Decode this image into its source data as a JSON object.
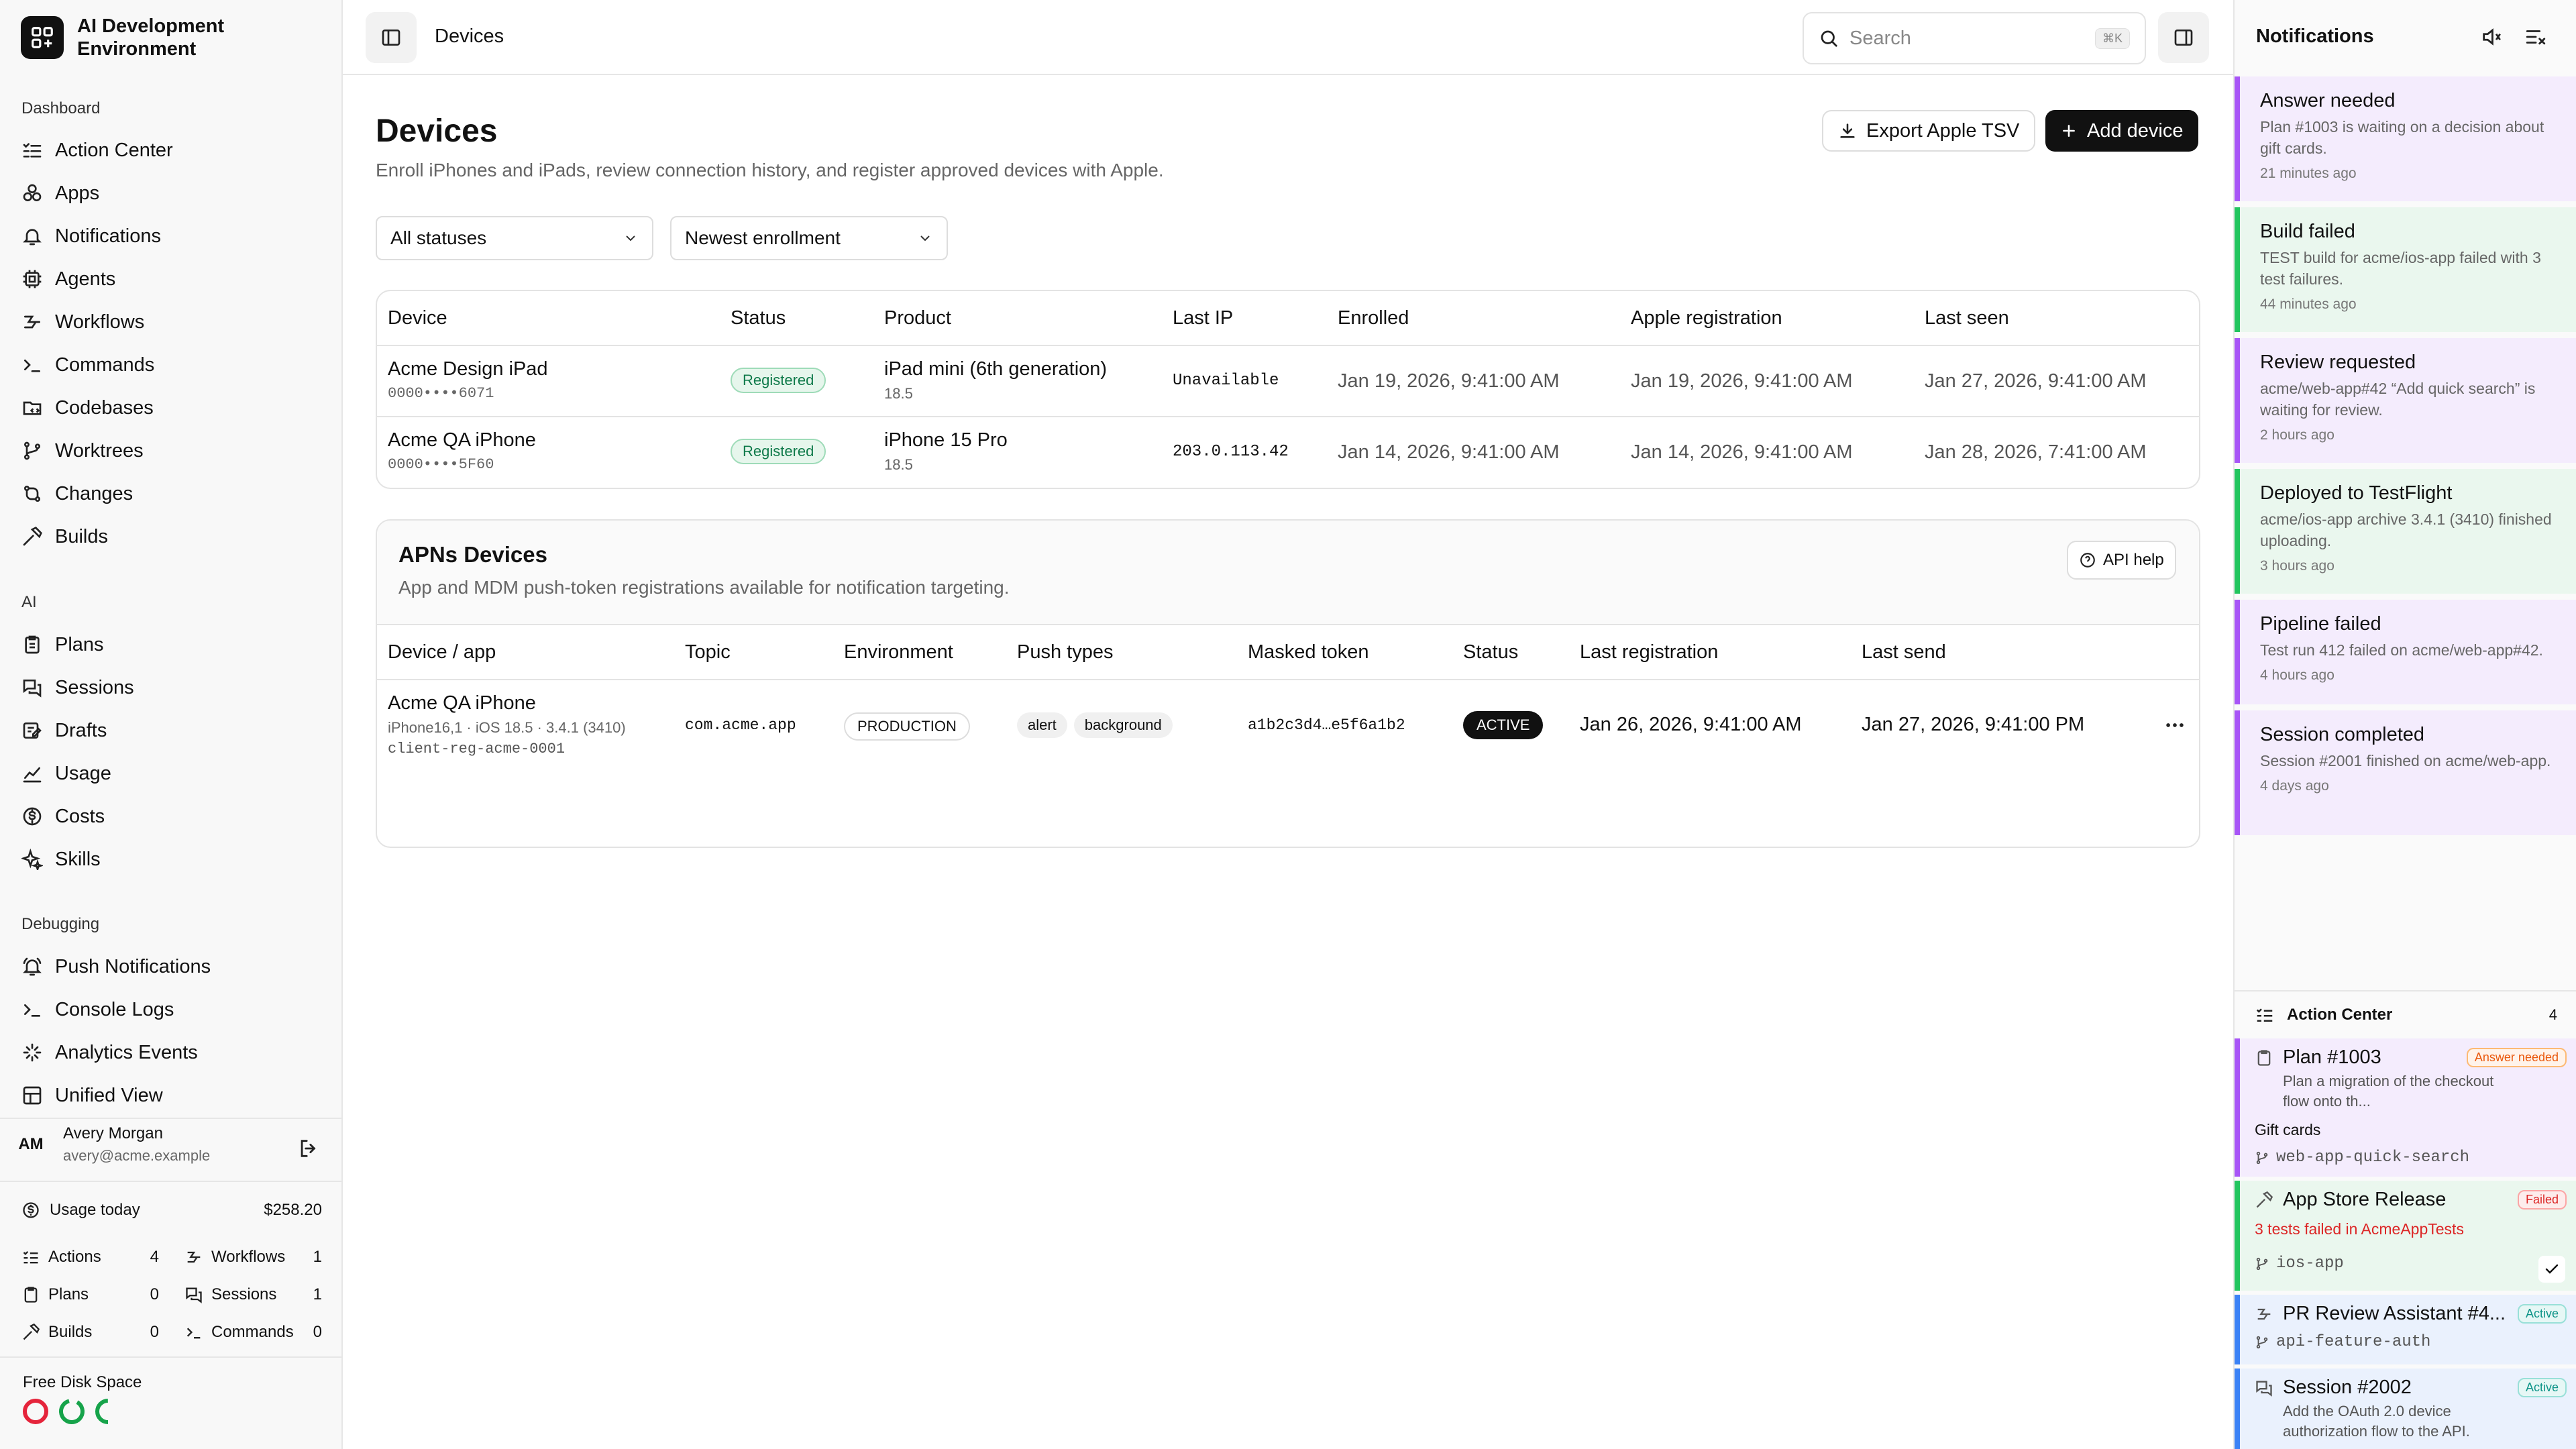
{
  "app": {
    "title": "AI Development Environment"
  },
  "sidebar": {
    "groups": [
      "Dashboard",
      "AI",
      "Debugging"
    ],
    "items": [
      {
        "label": "Action Center",
        "icon": "list-check-icon"
      },
      {
        "label": "Apps",
        "icon": "apps-icon"
      },
      {
        "label": "Notifications",
        "icon": "bell-icon"
      },
      {
        "label": "Agents",
        "icon": "agent-icon"
      },
      {
        "label": "Workflows",
        "icon": "workflow-icon"
      },
      {
        "label": "Commands",
        "icon": "terminal-icon"
      },
      {
        "label": "Codebases",
        "icon": "folder-icon"
      },
      {
        "label": "Worktrees",
        "icon": "branch-icon"
      },
      {
        "label": "Changes",
        "icon": "diff-icon"
      },
      {
        "label": "Builds",
        "icon": "hammer-icon"
      },
      {
        "label": "Plans",
        "icon": "clipboard-icon"
      },
      {
        "label": "Sessions",
        "icon": "chat-icon"
      },
      {
        "label": "Drafts",
        "icon": "draft-icon"
      },
      {
        "label": "Usage",
        "icon": "chart-icon"
      },
      {
        "label": "Costs",
        "icon": "dollar-icon"
      },
      {
        "label": "Skills",
        "icon": "sparkle-icon"
      },
      {
        "label": "Push Notifications",
        "icon": "bell-ring-icon"
      },
      {
        "label": "Console Logs",
        "icon": "terminal-icon"
      },
      {
        "label": "Analytics Events",
        "icon": "activity-icon"
      },
      {
        "label": "Unified View",
        "icon": "layout-icon"
      }
    ],
    "user": {
      "initials": "AM",
      "name": "Avery Morgan",
      "email": "avery@acme.example"
    },
    "usage": {
      "label": "Usage today",
      "value": "$258.20"
    },
    "stats": [
      {
        "label": "Actions",
        "value": "4"
      },
      {
        "label": "Workflows",
        "value": "1"
      },
      {
        "label": "Plans",
        "value": "0"
      },
      {
        "label": "Sessions",
        "value": "1"
      },
      {
        "label": "Builds",
        "value": "0"
      },
      {
        "label": "Commands",
        "value": "0"
      }
    ],
    "disk": {
      "label": "Free Disk Space",
      "colors": [
        "#e5243b",
        "#16a34a",
        "#16a34a"
      ]
    }
  },
  "topbar": {
    "breadcrumb": "Devices",
    "search_placeholder": "Search",
    "search_shortcut": "⌘K"
  },
  "page": {
    "title": "Devices",
    "subtitle": "Enroll iPhones and iPads, review connection history, and register approved devices with Apple.",
    "export_label": "Export Apple TSV",
    "add_label": "Add device",
    "filter_status": "All statuses",
    "filter_sort": "Newest enrollment"
  },
  "devices_table": {
    "columns": [
      "Device",
      "Status",
      "Product",
      "Last IP",
      "Enrolled",
      "Apple registration",
      "Last seen"
    ],
    "rows": [
      {
        "name": "Acme Design iPad",
        "udid": "0000••••6071",
        "status": "Registered",
        "product": "iPad mini (6th generation)",
        "os": "18.5",
        "ip": "Unavailable",
        "enrolled": "Jan 19, 2026, 9:41:00 AM",
        "apple": "Jan 19, 2026, 9:41:00 AM",
        "seen": "Jan 27, 2026, 9:41:00 AM"
      },
      {
        "name": "Acme QA iPhone",
        "udid": "0000••••5F60",
        "status": "Registered",
        "product": "iPhone 15 Pro",
        "os": "18.5",
        "ip": "203.0.113.42",
        "enrolled": "Jan 14, 2026, 9:41:00 AM",
        "apple": "Jan 14, 2026, 9:41:00 AM",
        "seen": "Jan 28, 2026, 7:41:00 AM"
      }
    ]
  },
  "apns": {
    "title": "APNs Devices",
    "subtitle": "App and MDM push-token registrations available for notification targeting.",
    "help_label": "API help",
    "columns": [
      "Device / app",
      "Topic",
      "Environment",
      "Push types",
      "Masked token",
      "Status",
      "Last registration",
      "Last send"
    ],
    "rows": [
      {
        "name": "Acme QA iPhone",
        "meta": "iPhone16,1 · iOS 18.5 · 3.4.1 (3410)",
        "client": "client-reg-acme-0001",
        "topic": "com.acme.app",
        "env": "PRODUCTION",
        "push_types": [
          "alert",
          "background"
        ],
        "token": "a1b2c3d4…e5f6a1b2",
        "status": "ACTIVE",
        "last_reg": "Jan 26, 2026, 9:41:00 AM",
        "last_send": "Jan 27, 2026, 9:41:00 PM"
      }
    ]
  },
  "notifications": {
    "title": "Notifications",
    "items": [
      {
        "title": "Answer needed",
        "body": "Plan #1003 is waiting on a decision about gift cards.",
        "when": "21 minutes ago",
        "color": "#a855f7",
        "bg": "#f4ecfd"
      },
      {
        "title": "Build failed",
        "body": "TEST build for acme/ios-app failed with 3 test failures.",
        "when": "44 minutes ago",
        "color": "#22c55e",
        "bg": "#eaf7ee"
      },
      {
        "title": "Review requested",
        "body": "acme/web-app#42 “Add quick search” is waiting for review.",
        "when": "2 hours ago",
        "color": "#a855f7",
        "bg": "#f4ecfd"
      },
      {
        "title": "Deployed to TestFlight",
        "body": "acme/ios-app archive 3.4.1 (3410) finished uploading.",
        "when": "3 hours ago",
        "color": "#22c55e",
        "bg": "#eaf7ee"
      },
      {
        "title": "Pipeline failed",
        "body": "Test run 412 failed on acme/web-app#42.",
        "when": "4 hours ago",
        "color": "#a855f7",
        "bg": "#f4ecfd"
      },
      {
        "title": "Session completed",
        "body": "Session #2001 finished on acme/web-app.",
        "when": "4 days ago",
        "color": "#a855f7",
        "bg": "#f4ecfd"
      }
    ]
  },
  "action_center": {
    "title": "Action Center",
    "count": "4",
    "cards": [
      {
        "title": "Plan #1003",
        "badge": "Answer needed",
        "body": "Plan a migration of the checkout flow onto th...",
        "extra": "Gift cards",
        "branch": "web-app-quick-search",
        "color": "#a855f7",
        "bg": "#f4ecfd",
        "badge_color": "#ea580c"
      },
      {
        "title": "App Store Release",
        "badge": "Failed",
        "body": "3 tests failed in AcmeAppTests",
        "branch": "ios-app",
        "color": "#22c55e",
        "bg": "#eaf7ee",
        "badge_color": "#dc2626"
      },
      {
        "title": "PR Review Assistant #4...",
        "badge": "Active",
        "branch": "api-feature-auth",
        "color": "#3b82f6",
        "bg": "#eaf1fd",
        "badge_color": "#0d9488"
      },
      {
        "title": "Session #2002",
        "badge": "Active",
        "body": "Add the OAuth 2.0 device authorization flow to the API.",
        "color": "#3b82f6",
        "bg": "#eaf1fd",
        "badge_color": "#0d9488"
      }
    ]
  }
}
